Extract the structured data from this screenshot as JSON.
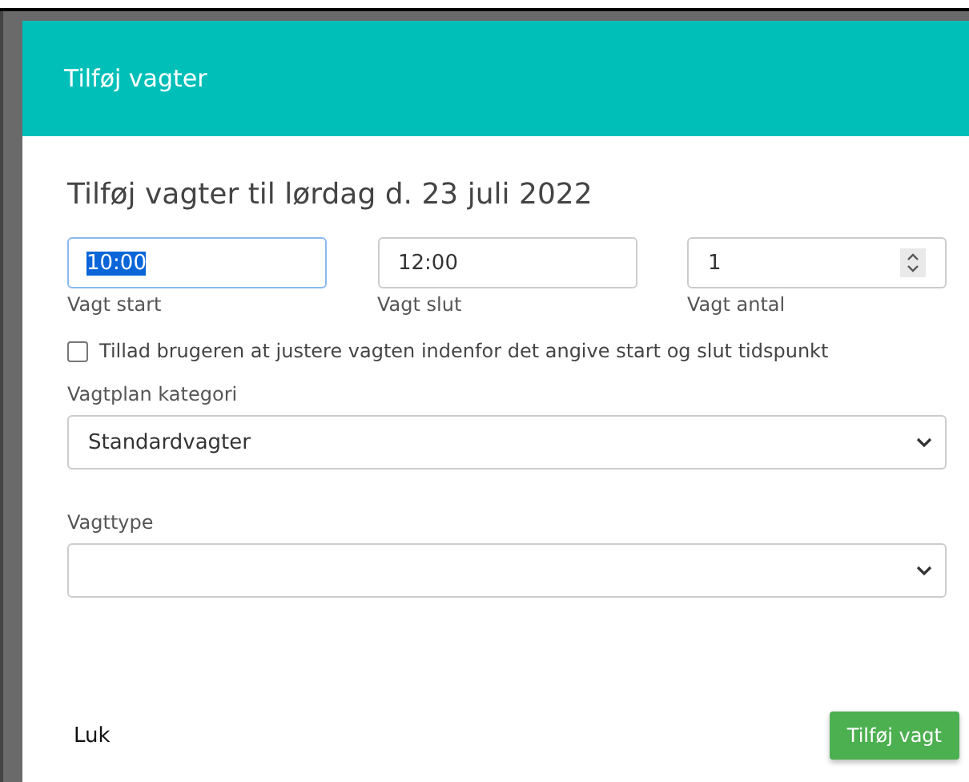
{
  "dialog": {
    "title": "Tilføj vagter"
  },
  "heading": "Tilføj vagter til lørdag d. 23 juli 2022",
  "fields": [
    {
      "kind": "time",
      "label": "Vagt start",
      "value": "10:00",
      "focused": true
    },
    {
      "kind": "time",
      "label": "Vagt slut",
      "value": "12:00",
      "focused": false
    },
    {
      "kind": "number",
      "label": "Vagt antal",
      "value": "1",
      "focused": false
    }
  ],
  "checkbox": {
    "label": "Tillad brugeren at justere vagten indenfor det angive start og slut tidspunkt",
    "checked": false
  },
  "selects": [
    {
      "label": "Vagtplan kategori",
      "value": "Standardvagter"
    },
    {
      "label": "Vagttype"
    }
  ],
  "footer": {
    "close": "Luk",
    "submit": "Tilføj vagt"
  }
}
